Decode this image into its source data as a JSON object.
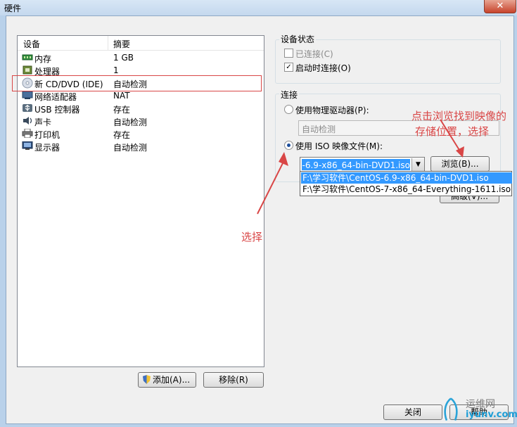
{
  "window": {
    "title": "硬件",
    "close_glyph": "✕"
  },
  "device_list": {
    "columns": [
      "设备",
      "摘要"
    ],
    "rows": [
      {
        "icon": "memory-icon",
        "device": "内存",
        "summary": "1 GB"
      },
      {
        "icon": "processor-icon",
        "device": "处理器",
        "summary": "1"
      },
      {
        "icon": "cd-dvd-icon",
        "device": "新 CD/DVD (IDE)",
        "summary": "自动检测"
      },
      {
        "icon": "network-adapter-icon",
        "device": "网络适配器",
        "summary": "NAT"
      },
      {
        "icon": "usb-icon",
        "device": "USB 控制器",
        "summary": "存在"
      },
      {
        "icon": "sound-card-icon",
        "device": "声卡",
        "summary": "自动检测"
      },
      {
        "icon": "printer-icon",
        "device": "打印机",
        "summary": "存在"
      },
      {
        "icon": "display-icon",
        "device": "显示器",
        "summary": "自动检测"
      }
    ],
    "add_label": "添加(A)...",
    "remove_label": "移除(R)"
  },
  "device_status": {
    "label": "设备状态",
    "connected_label": "已连接(C)",
    "connected": false,
    "connect_at_power_on_label": "启动时连接(O)",
    "connect_at_power_on": true
  },
  "connection": {
    "label": "连接",
    "physical_label": "使用物理驱动器(P):",
    "physical_value": "自动检测",
    "iso_label": "使用 ISO 映像文件(M):",
    "iso_selected": true,
    "iso_value": "F:\\学习软件\\CentOS-6.9-x86_64-bin-DVD1.iso",
    "iso_options": [
      "F:\\学习软件\\CentOS-6.9-x86_64-bin-DVD1.iso",
      "F:\\学习软件\\CentOS-7-x86_64-Everything-1611.iso"
    ],
    "browse_label": "浏览(B)...",
    "advanced_label": "高级(V)..."
  },
  "annotations": {
    "select_text": "选择",
    "browse_hint_line1": "点击浏览找到映像的",
    "browse_hint_line2": "存储位置，选择"
  },
  "footer": {
    "close_label": "关闭",
    "help_label": "帮助"
  },
  "watermark": {
    "line1": "运维网",
    "line2": "iyunv.com"
  },
  "colors": {
    "accent": "#3399ff",
    "annotation": "#d94646"
  }
}
